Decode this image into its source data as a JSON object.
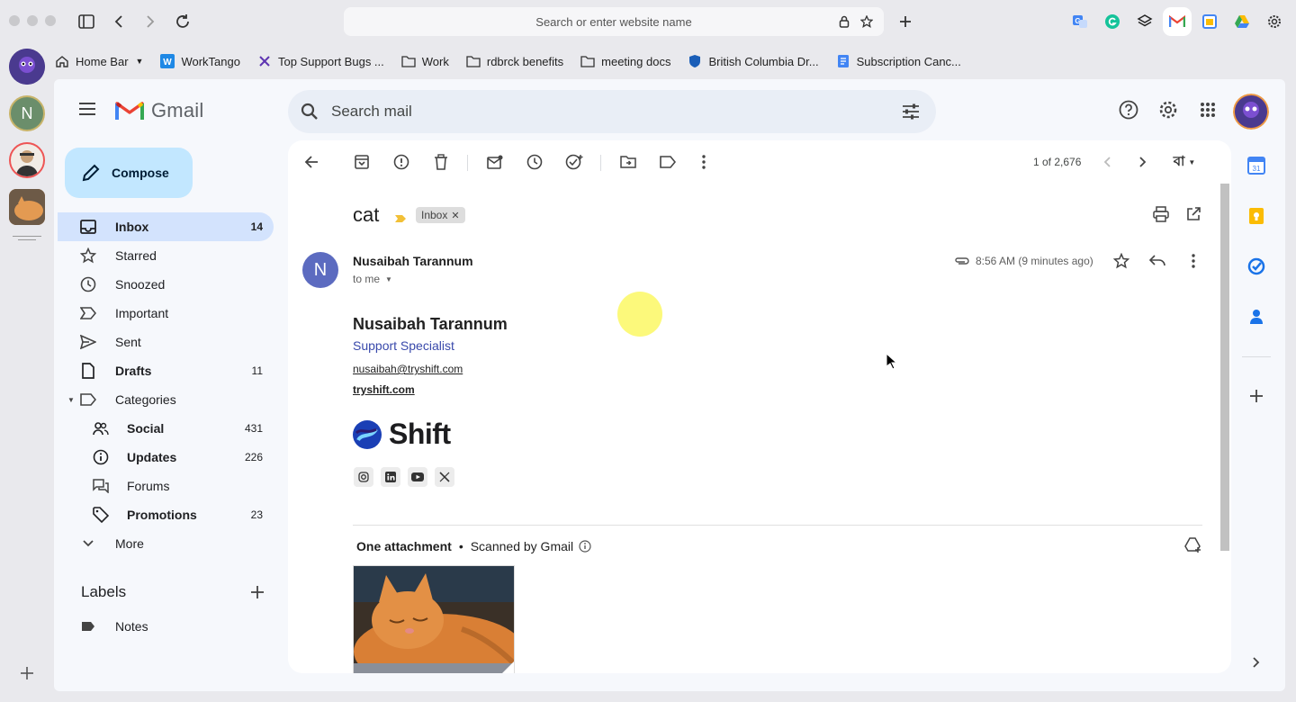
{
  "browser": {
    "address_placeholder": "Search or enter website name",
    "bookmarks": [
      {
        "label": "Home Bar",
        "icon": "home-icon"
      },
      {
        "label": "WorkTango",
        "icon": "worktango-icon"
      },
      {
        "label": "Top Support Bugs ...",
        "icon": "linear-icon"
      },
      {
        "label": "Work",
        "icon": "folder-icon"
      },
      {
        "label": "rdbrck benefits",
        "icon": "folder-icon"
      },
      {
        "label": "meeting docs",
        "icon": "folder-icon"
      },
      {
        "label": "British Columbia Dr...",
        "icon": "shield-icon"
      },
      {
        "label": "Subscription Canc...",
        "icon": "doc-icon"
      }
    ],
    "rail_avatar_letter": "N"
  },
  "gmail": {
    "logo_text": "Gmail",
    "search_placeholder": "Search mail",
    "compose_label": "Compose",
    "nav": [
      {
        "label": "Inbox",
        "count": "14",
        "icon": "inbox-icon"
      },
      {
        "label": "Starred",
        "count": "",
        "icon": "star-icon"
      },
      {
        "label": "Snoozed",
        "count": "",
        "icon": "clock-icon"
      },
      {
        "label": "Important",
        "count": "",
        "icon": "important-icon"
      },
      {
        "label": "Sent",
        "count": "",
        "icon": "send-icon"
      },
      {
        "label": "Drafts",
        "count": "11",
        "icon": "draft-icon"
      },
      {
        "label": "Categories",
        "count": "",
        "icon": "label-icon"
      },
      {
        "label": "Social",
        "count": "431",
        "icon": "people-icon"
      },
      {
        "label": "Updates",
        "count": "226",
        "icon": "info-icon"
      },
      {
        "label": "Forums",
        "count": "",
        "icon": "forum-icon"
      },
      {
        "label": "Promotions",
        "count": "23",
        "icon": "tag-icon"
      },
      {
        "label": "More",
        "count": "",
        "icon": "chevron-down-icon"
      }
    ],
    "labels_heading": "Labels",
    "labels": [
      {
        "label": "Notes"
      }
    ],
    "pager": "1 of 2,676",
    "input_tool": "বা"
  },
  "email": {
    "subject": "cat",
    "tag": "Inbox",
    "avatar_letter": "N",
    "sender": "Nusaibah Tarannum",
    "to": "to me",
    "timestamp": "8:56 AM (9 minutes ago)",
    "signature": {
      "name": "Nusaibah Tarannum",
      "role": "Support Specialist",
      "email": "nusaibah@tryshift.com",
      "site": "tryshift.com",
      "company": "Shift"
    },
    "attachment_count": "One attachment",
    "scanned": "Scanned by Gmail"
  },
  "colors": {
    "compose_bg": "#c2e7ff",
    "active_nav": "#d3e3fd",
    "role_link": "#3949ab",
    "avatar_bg": "#5c6bc0"
  }
}
